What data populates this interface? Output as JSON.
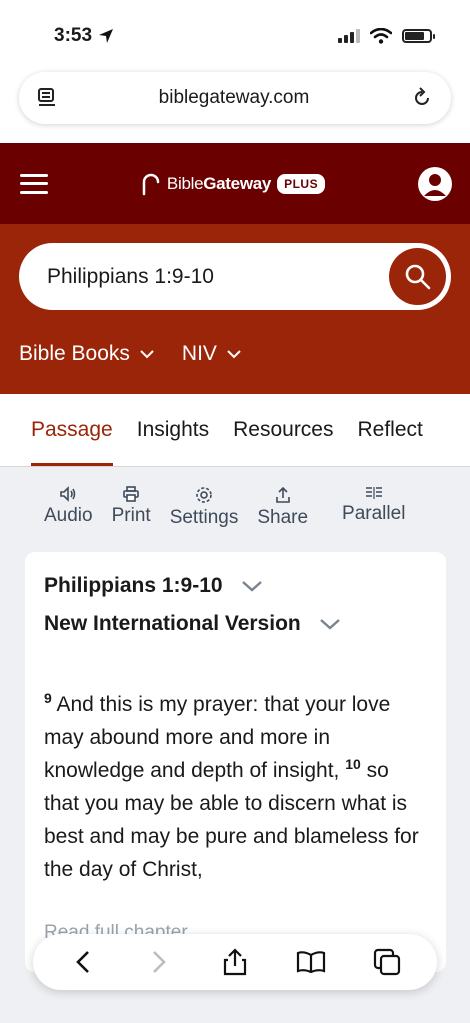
{
  "status_bar": {
    "time": "3:53"
  },
  "browser": {
    "url": "biblegateway.com"
  },
  "header": {
    "logo_text_light": "Bible",
    "logo_text_bold": "Gateway",
    "plus_badge": "PLUS"
  },
  "search": {
    "value": "Philippians 1:9-10"
  },
  "selectors": {
    "books_label": "Bible Books",
    "version_label": "NIV"
  },
  "tabs": [
    {
      "label": "Passage"
    },
    {
      "label": "Insights"
    },
    {
      "label": "Resources"
    },
    {
      "label": "Reflect"
    }
  ],
  "toolbar": {
    "audio": "Audio",
    "print": "Print",
    "settings": "Settings",
    "share": "Share",
    "parallel": "Parallel"
  },
  "passage": {
    "reference": "Philippians 1:9-10",
    "version_name": "New International Version",
    "verse9_num": "9",
    "verse9_text": "And this is my prayer: that your love may abound more and more in knowledge and depth of insight,",
    "verse10_num": "10",
    "verse10_text": "so that you may be able to discern what is best and may be pure and blameless for the day of Christ,",
    "read_full": "Read full chapter"
  },
  "colors": {
    "header_bg": "#6b0000",
    "search_bg": "#9a2508",
    "accent": "#9a2508",
    "content_bg": "#eef0f3"
  }
}
